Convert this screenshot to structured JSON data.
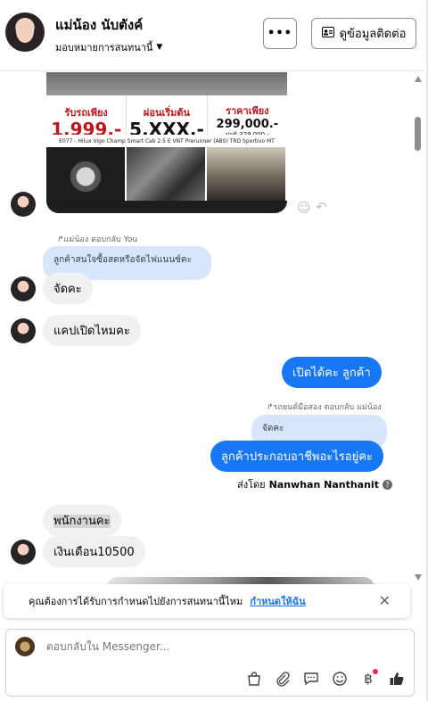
{
  "header": {
    "name": "แม่น้อง นับตังค์",
    "subtitle": "มอบหมายการสนทนานี้",
    "more_label": "•••",
    "contact_label": "ดูข้อมูลติดต่อ"
  },
  "ad_image": {
    "col1_label": "รับรถเพียง",
    "col1_value": "1,999.-",
    "col2_label": "ผ่อนเริ่มต้น",
    "col2_value": "5,XXX.-",
    "col3_label": "ราคาเพียง",
    "col3_value": "299,000.-",
    "col3_sub": "ปกติ 329,000.-",
    "caption": "E077 - Hilux Vigo Champ Smart Cab 2.5 E VNT Prerunner (ABS) TRD Sportivo MT"
  },
  "messages": {
    "reply_note_1": "แม่น้อง ตอบกลับ You",
    "quote_1": "ลูกค้าสนใจซื้อสดหรือจัดไฟแนนซ์คะ",
    "msg_1": "จัดคะ",
    "msg_2": "แคปเปิดไหมคะ",
    "msg_3": "เปิดได้คะ  ลูกค้า",
    "reply_note_2": "รถยนต์มือสอง ตอบกลับ แม่น้อง",
    "quote_2": "จัดคะ",
    "msg_4": "ลูกค้าประกอบอาชีพอะไรอยู่คะ",
    "sent_by_prefix": "ส่งโดย",
    "sent_by_name": "Nanwhan Nanthanit",
    "msg_5": "พนักงานคะ",
    "msg_6": "เงินเดือน10500"
  },
  "banner": {
    "text": "คุณต้องการได้รับการกำหนดไปยังการสนทนานี้ไหม",
    "link": "กำหนดให้ฉัน"
  },
  "composer": {
    "placeholder": "ตอบกลับใน Messenger..."
  },
  "icons": {
    "more": "more-horizontal-icon",
    "contact": "contact-card-icon",
    "emoji_react": "smile-icon",
    "reply": "reply-arrow-icon",
    "info": "info-icon",
    "close": "close-icon",
    "bag": "shopping-bag-icon",
    "attach": "paperclip-icon",
    "saved_reply": "saved-reply-icon",
    "emoji": "emoji-icon",
    "payment": "baht-icon",
    "like": "thumbs-up-icon"
  },
  "colors": {
    "outgoing": "#1877f2",
    "incoming": "#f0f0f0",
    "quote": "#d8e6fd",
    "link": "#1877f2",
    "notify": "#f02849"
  }
}
